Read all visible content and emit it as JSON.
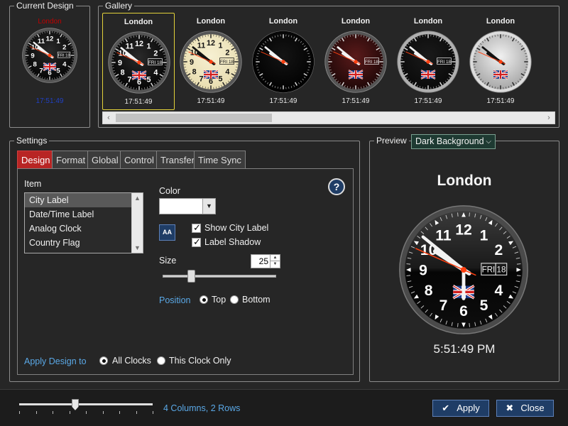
{
  "current_design": {
    "title": "Current Design",
    "city": "London",
    "time": "17:51:49",
    "date_day": "FRI",
    "date_num": "18"
  },
  "gallery": {
    "title": "Gallery",
    "items": [
      {
        "city": "London",
        "time": "17:51:49"
      },
      {
        "city": "London",
        "time": "17:51:49"
      },
      {
        "city": "London",
        "time": "17:51:49"
      },
      {
        "city": "London",
        "time": "17:51:49"
      },
      {
        "city": "London",
        "time": "17:51:49"
      },
      {
        "city": "London",
        "time": "17:51:49"
      }
    ],
    "date_day": "FRI",
    "date_num": "18"
  },
  "settings": {
    "title": "Settings",
    "tabs": [
      "Design",
      "Format",
      "Global",
      "Control",
      "Transfer",
      "Time Sync"
    ],
    "item_label": "Item",
    "items": [
      "City Label",
      "Date/Time Label",
      "Analog Clock",
      "Country Flag"
    ],
    "color_label": "Color",
    "show_city_label": "Show City Label",
    "label_shadow": "Label Shadow",
    "size_label": "Size",
    "size_value": "25",
    "size_slider_fraction": 0.25,
    "position_label": "Position",
    "position_top": "Top",
    "position_bottom": "Bottom",
    "apply_design_label": "Apply Design to",
    "apply_all": "All Clocks",
    "apply_this": "This Clock Only",
    "help": "?",
    "font_button": "AA"
  },
  "preview": {
    "title": "Preview",
    "background_option": "Dark Background",
    "city": "London",
    "time": "5:51:49 PM",
    "date_day": "FRI",
    "date_num": "18",
    "numbers": [
      "12",
      "1",
      "2",
      "",
      "4",
      "5",
      "6",
      "7",
      "8",
      "9",
      "10",
      "11"
    ]
  },
  "footer": {
    "layout_label": "4 Columns, 2 Rows",
    "apply": "Apply",
    "close": "Close",
    "layout_slider_fraction": 0.42
  },
  "colors": {
    "tab_active": "#b82524",
    "accent_blue": "#5aa8e6",
    "button_bg": "#1f3d66",
    "selected_border": "#e3d23a",
    "second_hand": "#ff4010"
  }
}
